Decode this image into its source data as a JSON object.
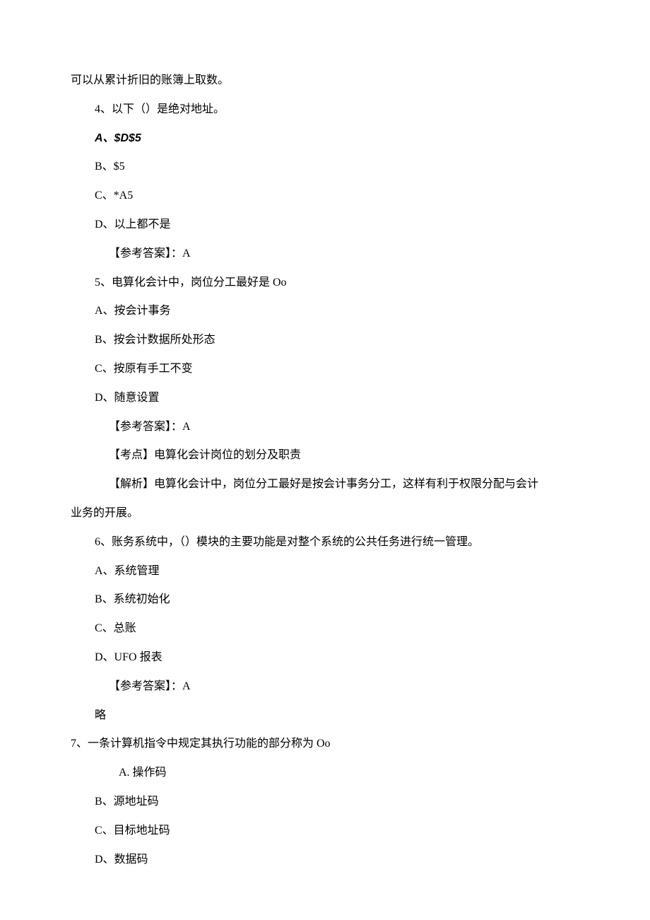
{
  "lines": [
    {
      "cls": "indent-0",
      "text": "可以从累计折旧的账簿上取数。"
    },
    {
      "cls": "indent-1",
      "text": "4、以下（）是绝对地址。"
    },
    {
      "cls": "indent-1 sans",
      "text": "A、$D$5"
    },
    {
      "cls": "indent-1",
      "text": "B、$5"
    },
    {
      "cls": "indent-1",
      "text": "C、*A5"
    },
    {
      "cls": "indent-1",
      "text": "D、以上都不是"
    },
    {
      "cls": "indent-2",
      "text": "【参考答案】：A"
    },
    {
      "cls": "indent-1",
      "text": "5、电算化会计中，岗位分工最好是 Oo"
    },
    {
      "cls": "indent-1",
      "text": "A、按会计事务"
    },
    {
      "cls": "indent-1",
      "text": "B、按会计数据所处形态"
    },
    {
      "cls": "indent-1",
      "text": "C、按原有手工不变"
    },
    {
      "cls": "indent-1",
      "text": "D、随意设置"
    },
    {
      "cls": "indent-2",
      "text": "【参考答案】：A"
    },
    {
      "cls": "indent-2",
      "text": "【考点】电算化会计岗位的划分及职责"
    },
    {
      "cls": "indent-2",
      "text": "【解析】电算化会计中，岗位分工最好是按会计事务分工，这样有利于权限分配与会计"
    },
    {
      "cls": "indent-0",
      "text": "业务的开展。"
    },
    {
      "cls": "indent-1",
      "text": "6、账务系统中，（）模块的主要功能是对整个系统的公共任务进行统一管理。"
    },
    {
      "cls": "indent-1",
      "text": "A、系统管理"
    },
    {
      "cls": "indent-1",
      "text": "B、系统初始化"
    },
    {
      "cls": "indent-1",
      "text": "C、总账"
    },
    {
      "cls": "indent-1",
      "text": "D、UFO 报表"
    },
    {
      "cls": "indent-2",
      "text": "【参考答案】：A"
    },
    {
      "cls": "indent-1",
      "text": "略"
    },
    {
      "cls": "indent-0",
      "text": "7、一条计算机指令中规定其执行功能的部分称为 Oo"
    },
    {
      "cls": "indent-3",
      "text": "A. 操作码"
    },
    {
      "cls": "indent-1",
      "text": "B、源地址码"
    },
    {
      "cls": "indent-1",
      "text": "C、目标地址码"
    },
    {
      "cls": "indent-1",
      "text": "D、数据码"
    }
  ]
}
